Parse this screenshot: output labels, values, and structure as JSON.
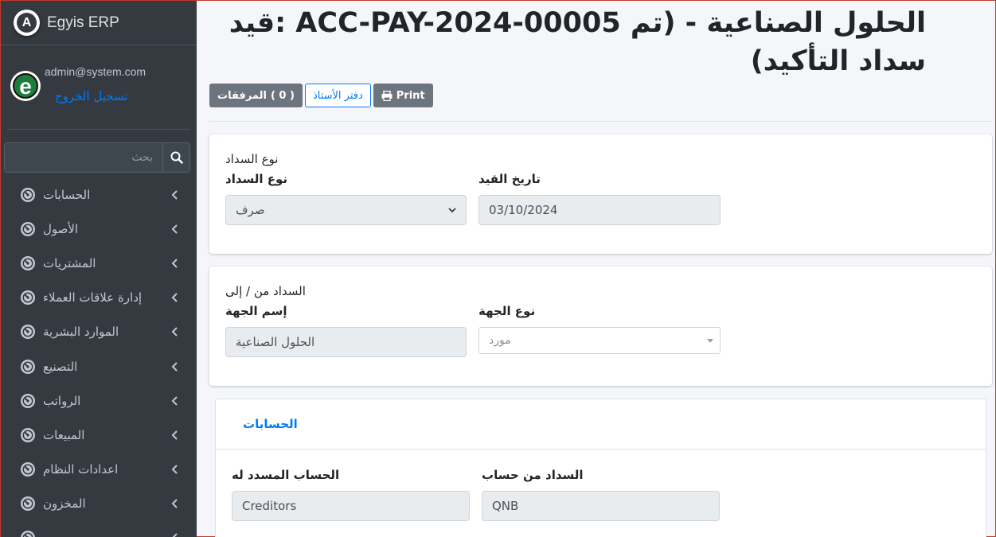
{
  "app": {
    "brand": "Egyis ERP",
    "brand_logo_letter": "A"
  },
  "user": {
    "email": "admin@system.com",
    "logout": "تسجيل الخروج",
    "avatar_letter": "e"
  },
  "search": {
    "placeholder": "بحث"
  },
  "sidebar": {
    "items": [
      {
        "label": "الحسابات"
      },
      {
        "label": "الأصول"
      },
      {
        "label": "المشتريات"
      },
      {
        "label": "إدارة علاقات العملاء"
      },
      {
        "label": "الموارد البشرية"
      },
      {
        "label": "التصنيع"
      },
      {
        "label": "الرواتب"
      },
      {
        "label": "المبيعات"
      },
      {
        "label": "اعدادات النظام"
      },
      {
        "label": "المخزون"
      },
      {
        "label": "..."
      }
    ]
  },
  "page": {
    "title": "الحلول الصناعية - (تم ACC-PAY-2024-00005 :قيد سداد التأكيد)"
  },
  "toolbar": {
    "attachments_label": "المرفقات",
    "attachments_count": "( 0 )",
    "ledger_label": "دفتر الأستاذ",
    "print_label": "Print"
  },
  "payment_type_section": {
    "title": "نوع السداد",
    "payment_type_label": "نوع السداد",
    "payment_type_value": "صرف",
    "posting_date_label": "تاريخ القيد",
    "posting_date_value": "03/10/2024"
  },
  "party_section": {
    "title": "السداد من / إلى",
    "party_name_label": "إسم الجهة",
    "party_name_value": "الحلول الصناعية",
    "party_type_label": "نوع الجهة",
    "party_type_value": "مورد"
  },
  "accounts_section": {
    "tab_label": "الحسابات",
    "paid_to_label": "الحساب المسدد له",
    "paid_to_value": "Creditors",
    "paid_from_label": "السداد من حساب",
    "paid_from_value": "QNB"
  },
  "colors": {
    "sidebar_bg": "#343a40",
    "accent": "#007bff",
    "secondary": "#6c757d",
    "readonly_bg": "#e9ecef"
  }
}
